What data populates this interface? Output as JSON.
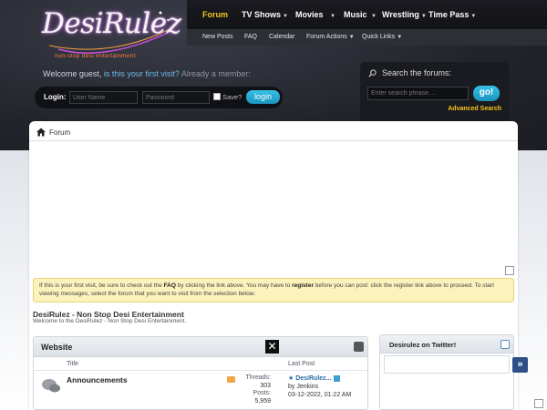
{
  "logo": {
    "text": "DesiRulez",
    "tagline": "non-stop desi entertainment"
  },
  "nav": {
    "items": [
      {
        "label": "Forum",
        "active": true,
        "has_caret": false
      },
      {
        "label": "TV Shows",
        "has_caret": true
      },
      {
        "label": "Movies",
        "has_caret": true
      },
      {
        "label": "Music",
        "has_caret": true
      },
      {
        "label": "Wrestling",
        "has_caret": true
      },
      {
        "label": "Time Pass",
        "has_caret": true
      }
    ],
    "subnav": [
      {
        "label": "New Posts"
      },
      {
        "label": "FAQ"
      },
      {
        "label": "Calendar"
      },
      {
        "label": "Forum Actions",
        "has_caret": true
      },
      {
        "label": "Quick Links",
        "has_caret": true
      }
    ]
  },
  "welcome": {
    "prefix": "Welcome guest, ",
    "link": "is this your first visit?",
    "suffix": " Already a member:"
  },
  "login": {
    "label": "Login:",
    "username_placeholder": "User Name",
    "password_placeholder": "Password",
    "save_label": "Save?",
    "button": "login"
  },
  "search": {
    "title": "Search the forums:",
    "placeholder": "Enter search phrase....",
    "button": "go!",
    "advanced": "Advanced Search"
  },
  "breadcrumb": {
    "label": "Forum"
  },
  "notice": {
    "t1": "If this is your first visit, be sure to check out the ",
    "faq": "FAQ",
    "t2": " by clicking the link above. You may have to ",
    "register": "register",
    "t3": " before you can post: click the register link above to proceed. To start viewing messages, select the forum that you want to visit from the selection below."
  },
  "forum": {
    "title": "DesiRulez - Non Stop Desi Entertainment",
    "description": "Welcome to the DesiRulez - Non Stop Desi Entertainment."
  },
  "block": {
    "title": "Website",
    "close": "✕",
    "col_title": "Title",
    "col_lastpost": "Last Post",
    "row": {
      "name": "Announcements",
      "threads_label": "Threads:",
      "threads": "303",
      "posts_label": "Posts:",
      "posts": "5,959",
      "last_title": "★ DesiRulez...",
      "last_by": "by Jenkins",
      "last_date": "03-12-2022, 01:22 AM"
    }
  },
  "sidebar": {
    "title": "Desirulez on Twitter!",
    "arrow": "»"
  },
  "colors": {
    "accent": "#1a93bf",
    "active_nav": "#f5c518",
    "notice_bg": "#fbf2bc"
  }
}
